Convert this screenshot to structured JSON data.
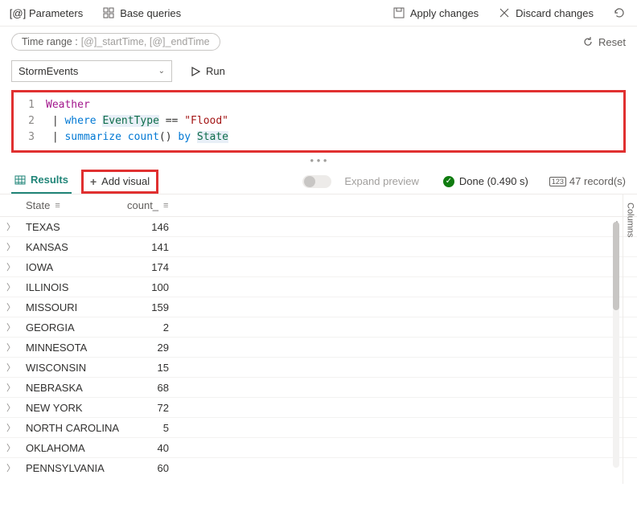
{
  "toolbar": {
    "parameters": "Parameters",
    "base_queries": "Base queries",
    "apply": "Apply changes",
    "discard": "Discard changes"
  },
  "time_range": {
    "label": "Time range :",
    "value": "[@]_startTime, [@]_endTime",
    "reset": "Reset"
  },
  "query": {
    "dropdown": "StormEvents",
    "run": "Run",
    "lines": [
      "1",
      "2",
      "3"
    ],
    "code": {
      "l1_table": "Weather",
      "l2_pipe": " | ",
      "l2_where": "where",
      "l2_col": "EventType",
      "l2_eq": " == ",
      "l2_str": "\"Flood\"",
      "l3_pipe": " | ",
      "l3_summarize": "summarize",
      "l3_count": "count",
      "l3_paren": "()",
      "l3_by": " by ",
      "l3_state": "State"
    }
  },
  "results": {
    "tab": "Results",
    "add_visual": "Add visual",
    "expand": "Expand preview",
    "status": "Done (0.490 s)",
    "records": "47 record(s)",
    "columns_rail": "Columns",
    "headers": {
      "state": "State",
      "count": "count_"
    },
    "rows": [
      {
        "state": "TEXAS",
        "count": "146"
      },
      {
        "state": "KANSAS",
        "count": "141"
      },
      {
        "state": "IOWA",
        "count": "174"
      },
      {
        "state": "ILLINOIS",
        "count": "100"
      },
      {
        "state": "MISSOURI",
        "count": "159"
      },
      {
        "state": "GEORGIA",
        "count": "2"
      },
      {
        "state": "MINNESOTA",
        "count": "29"
      },
      {
        "state": "WISCONSIN",
        "count": "15"
      },
      {
        "state": "NEBRASKA",
        "count": "68"
      },
      {
        "state": "NEW YORK",
        "count": "72"
      },
      {
        "state": "NORTH CAROLINA",
        "count": "5"
      },
      {
        "state": "OKLAHOMA",
        "count": "40"
      },
      {
        "state": "PENNSYLVANIA",
        "count": "60"
      }
    ]
  }
}
